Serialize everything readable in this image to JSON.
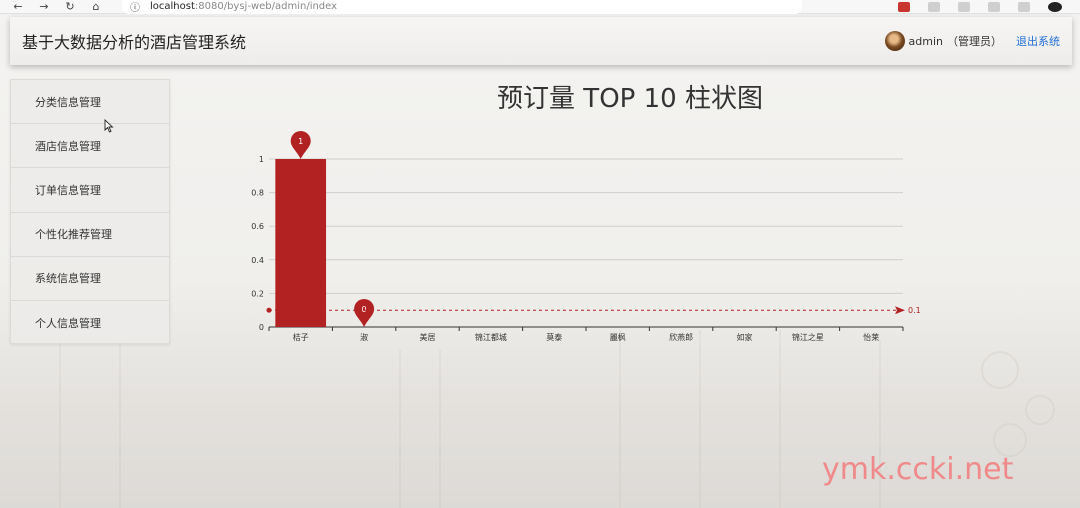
{
  "browser": {
    "host": "localhost",
    "path": ":8080/bysj-web/admin/index"
  },
  "header": {
    "title": "基于大数据分析的酒店管理系统",
    "username": "admin",
    "role": "（管理员）",
    "logout": "退出系统"
  },
  "sidebar": {
    "items": [
      {
        "label": "分类信息管理"
      },
      {
        "label": "酒店信息管理"
      },
      {
        "label": "订单信息管理"
      },
      {
        "label": "个性化推荐管理"
      },
      {
        "label": "系统信息管理"
      },
      {
        "label": "个人信息管理"
      }
    ]
  },
  "overlay": {
    "watermark": "",
    "brand": "ymk.ccki.net"
  },
  "colors": {
    "bar": "#b22222",
    "accent": "#1f6fd6"
  },
  "chart_data": {
    "type": "bar",
    "title": "预订量 TOP 10 柱状图",
    "categories": [
      "桔子",
      "淑",
      "美居",
      "锦江都城",
      "莫泰",
      "麗枫",
      "欣燕郎",
      "如家",
      "锦江之星",
      "怡莱"
    ],
    "values": [
      1,
      0,
      0,
      0,
      0,
      0,
      0,
      0,
      0,
      0
    ],
    "ylim": [
      0,
      1
    ],
    "yticks": [
      "0",
      "0.2",
      "0.4",
      "0.6",
      "0.8",
      "1"
    ],
    "grid": true,
    "markpoints": [
      {
        "category": "桔子",
        "label": "1"
      },
      {
        "category": "淑",
        "label": "0"
      }
    ],
    "markline": {
      "value": 0.1,
      "label": "0.1"
    }
  }
}
